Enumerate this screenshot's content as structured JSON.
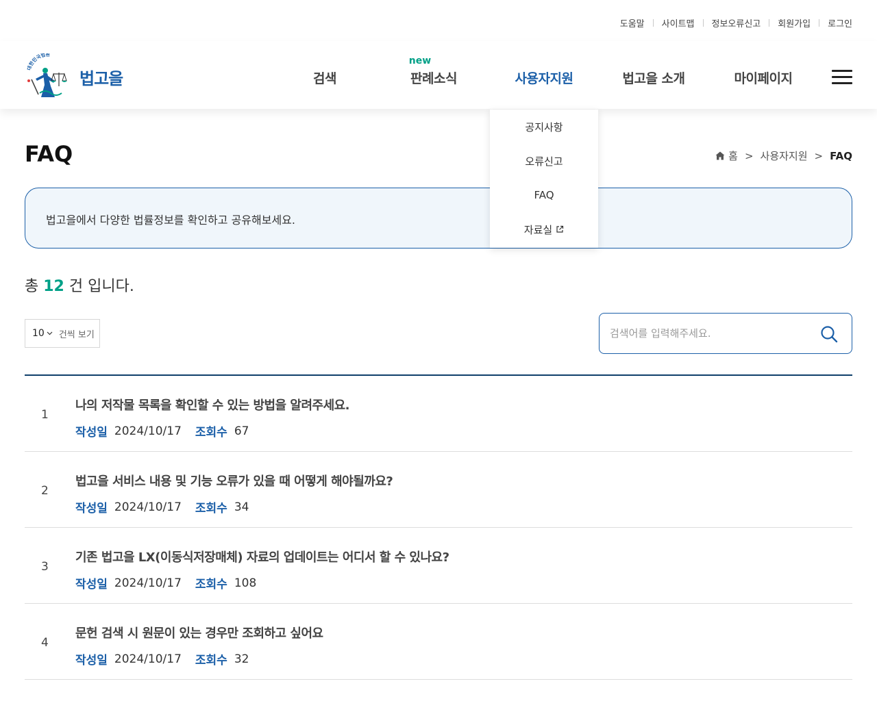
{
  "utility_links": [
    {
      "label": "도움말"
    },
    {
      "label": "사이트맵"
    },
    {
      "label": "정보오류신고"
    },
    {
      "label": "회원가입"
    },
    {
      "label": "로그인"
    }
  ],
  "logo": {
    "name": "법고을",
    "emblem_text": "대한민국법원"
  },
  "nav": {
    "items": [
      {
        "label": "검색"
      },
      {
        "label": "판례소식"
      },
      {
        "label": "사용자지원"
      },
      {
        "label": "법고을 소개"
      },
      {
        "label": "마이페이지"
      }
    ],
    "new_badge": "new",
    "active_color": "#1b5fa8",
    "badge_color": "#00a087"
  },
  "dropdown": {
    "items": [
      {
        "label": "공지사항"
      },
      {
        "label": "오류신고"
      },
      {
        "label": "FAQ"
      },
      {
        "label": "자료실"
      }
    ]
  },
  "page": {
    "title": "FAQ"
  },
  "breadcrumb": {
    "home": "홈",
    "section": "사용자지원",
    "current": "FAQ",
    "separator": ">"
  },
  "info": {
    "text": "법고을에서 다양한 법률정보를 확인하고 공유해보세요."
  },
  "total": {
    "prefix": "총",
    "count": "12",
    "suffix": "건 입니다."
  },
  "page_size": {
    "value": "10",
    "label": "건씩 보기"
  },
  "search": {
    "placeholder": "검색어를 입력해주세요."
  },
  "faq": {
    "date_label": "작성일",
    "views_label": "조회수",
    "rows": [
      {
        "num": "1",
        "question": "나의 저작물 목록을 확인할 수 있는 방법을 알려주세요.",
        "date": "2024/10/17",
        "views": "67"
      },
      {
        "num": "2",
        "question": "법고을 서비스 내용 및 기능 오류가 있을 때 어떻게 해야될까요?",
        "date": "2024/10/17",
        "views": "34"
      },
      {
        "num": "3",
        "question": "기존 법고을 LX(이동식저장매체) 자료의 업데이트는 어디서 할 수 있나요?",
        "date": "2024/10/17",
        "views": "108"
      },
      {
        "num": "4",
        "question": "문헌 검색 시 원문이 있는 경우만 조회하고 싶어요",
        "date": "2024/10/17",
        "views": "32"
      }
    ]
  }
}
